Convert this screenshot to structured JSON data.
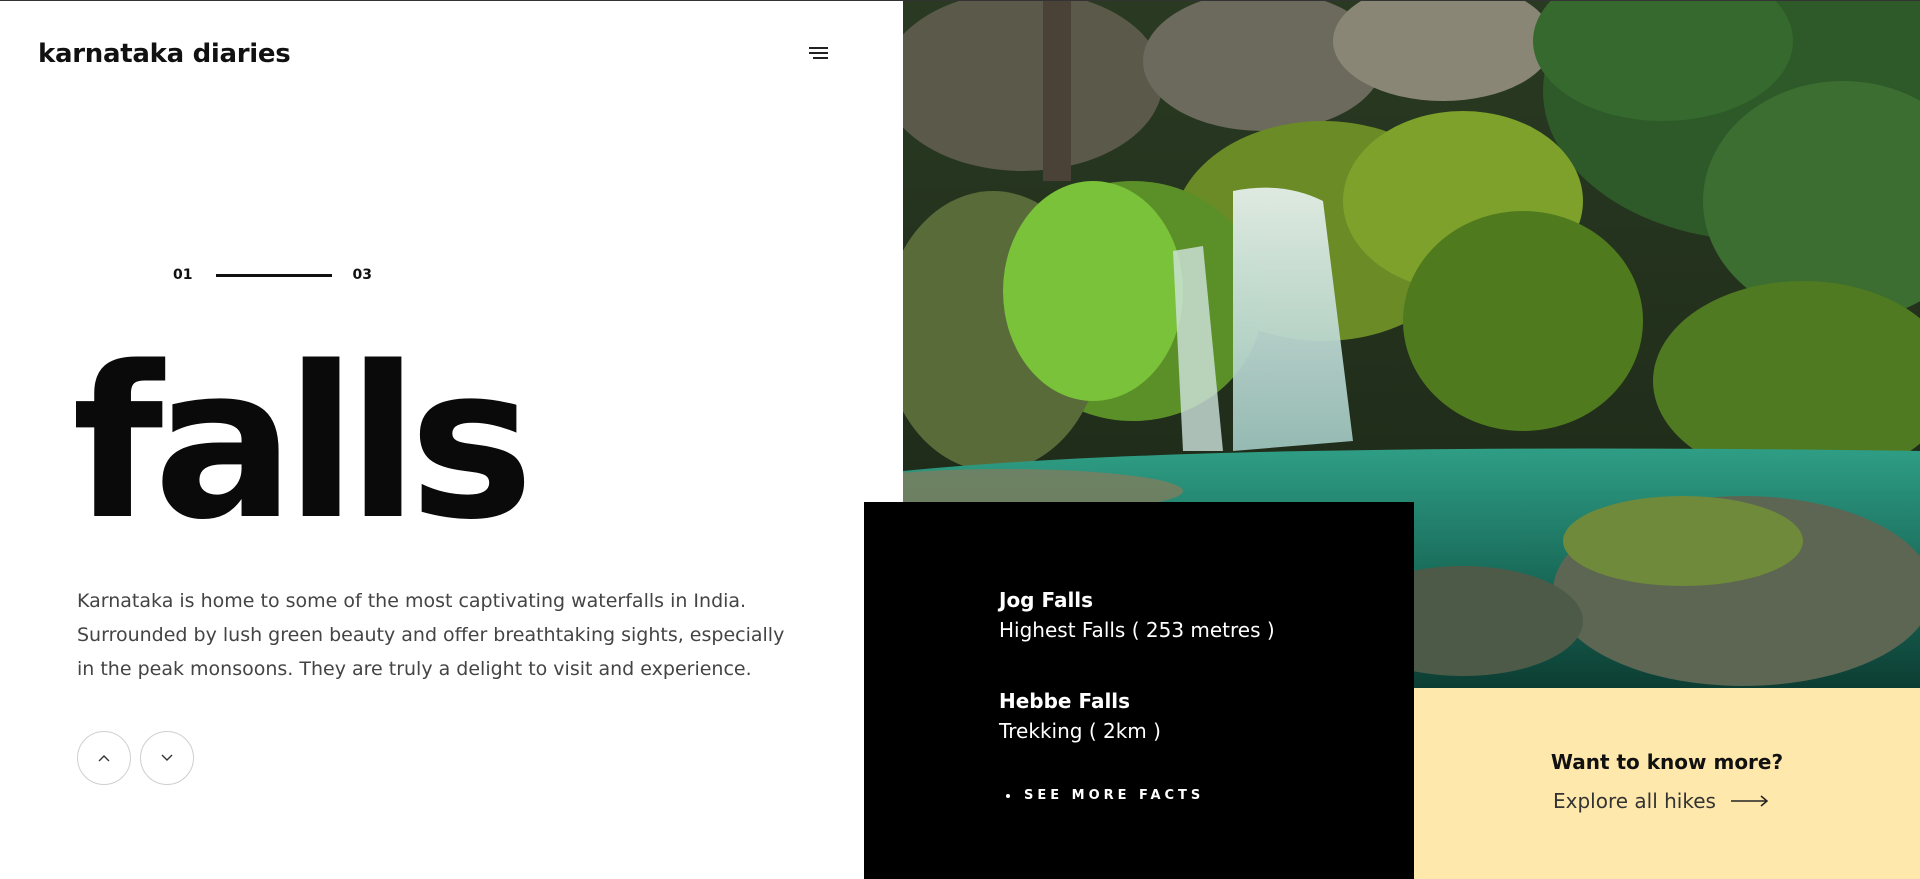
{
  "header": {
    "brand": "karnataka diaries",
    "menu_icon": "hamburger-menu-icon"
  },
  "slider": {
    "current": "01",
    "total": "03",
    "progress": 0.33
  },
  "hero": {
    "title": "falls",
    "description": "Karnataka is home to some of the most captivating waterfalls in India. Surrounded by lush green beauty and offer breathtaking sights, especially in the peak monsoons. They are truly a delight to visit and experience."
  },
  "nav": {
    "up_icon": "chevron-up-icon",
    "down_icon": "chevron-down-icon"
  },
  "facts": {
    "items": [
      {
        "name": "Jog Falls",
        "detail": "Highest Falls ( 253 metres )"
      },
      {
        "name": "Hebbe Falls",
        "detail": "Trekking ( 2km )"
      }
    ],
    "see_more": "SEE MORE FACTS"
  },
  "cta": {
    "question": "Want to know more?",
    "link": "Explore all hikes",
    "arrow_icon": "arrow-right-icon"
  },
  "colors": {
    "accent_yellow": "#fee8ab",
    "facts_bg": "#000000",
    "text": "#111111"
  }
}
